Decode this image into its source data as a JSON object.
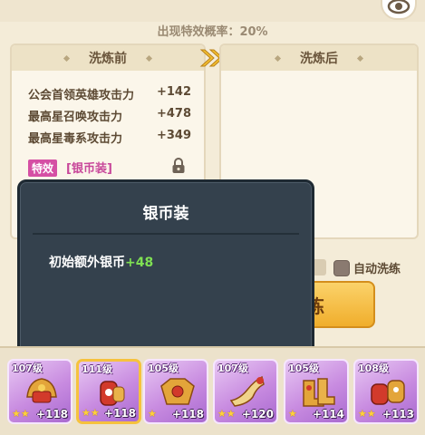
{
  "header": {
    "probability_text": "出现特效概率：20%",
    "eye_icon": "eye-icon"
  },
  "panel_before": {
    "title": "洗炼前",
    "stats": [
      {
        "label": "公会首领英雄攻击力",
        "value": "+142"
      },
      {
        "label": "最高星召唤攻击力",
        "value": "+478"
      },
      {
        "label": "最高星毒系攻击力",
        "value": "+349"
      }
    ],
    "effect_tag": "特效",
    "effect_name": "[银币装]"
  },
  "panel_after": {
    "title": "洗炼后"
  },
  "controls": {
    "auto_refine_label": "自动洗练",
    "refine_button_label": "洗炼"
  },
  "tooltip": {
    "title": "银币装",
    "desc_label": "初始额外银币",
    "desc_bonus": "+48"
  },
  "items": [
    {
      "level": "107级",
      "bonus": "+118",
      "stars": "★★"
    },
    {
      "level": "111级",
      "bonus": "+118",
      "stars": "★★"
    },
    {
      "level": "105级",
      "bonus": "+118",
      "stars": "★"
    },
    {
      "level": "107级",
      "bonus": "+120",
      "stars": "★★"
    },
    {
      "level": "105级",
      "bonus": "+114",
      "stars": "★"
    },
    {
      "level": "108级",
      "bonus": "+113",
      "stars": "★★"
    }
  ],
  "colors": {
    "background": "#f4ecd8",
    "tooltip_bg": "#34414d",
    "bonus_green": "#7fe053",
    "effect_pink": "#d54fa4",
    "item_purple": "#c88be0"
  }
}
